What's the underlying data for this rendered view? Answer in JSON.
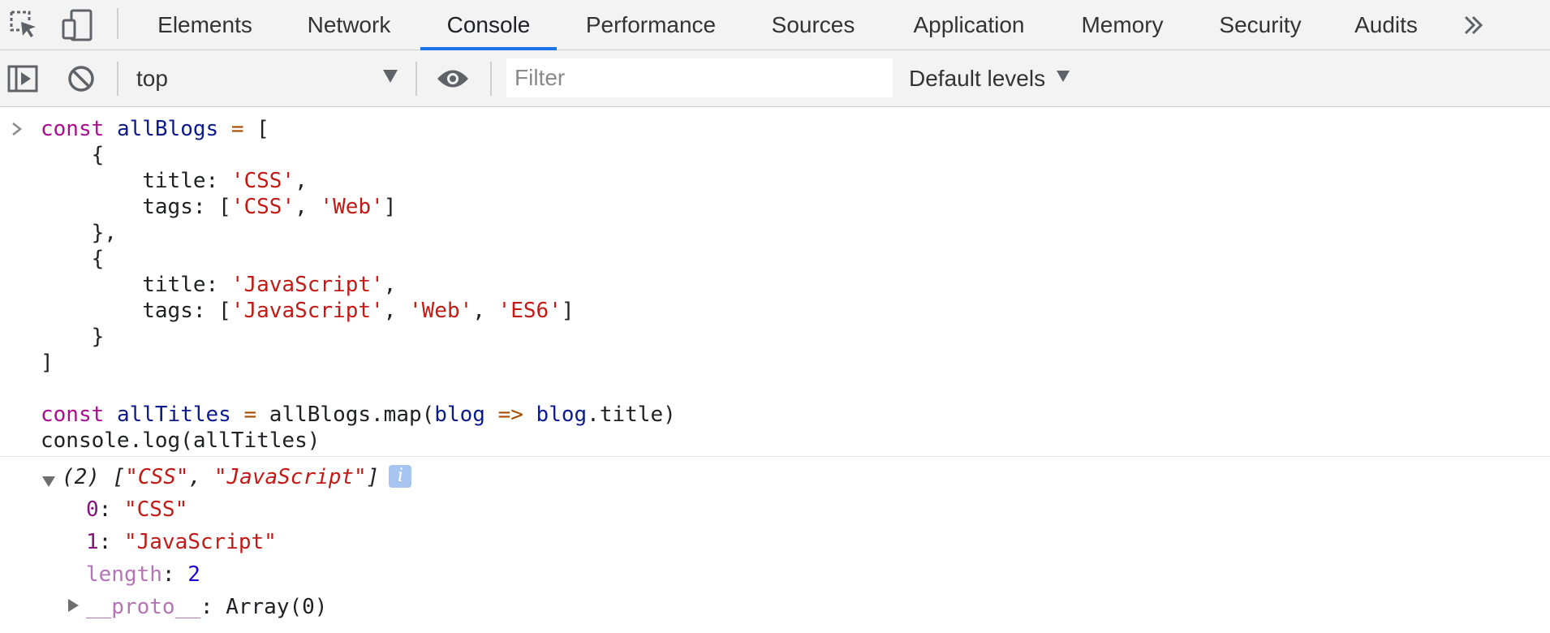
{
  "tabs": [
    {
      "label": "Elements",
      "active": false
    },
    {
      "label": "Network",
      "active": false
    },
    {
      "label": "Console",
      "active": true
    },
    {
      "label": "Performance",
      "active": false
    },
    {
      "label": "Sources",
      "active": false
    },
    {
      "label": "Application",
      "active": false
    },
    {
      "label": "Memory",
      "active": false
    },
    {
      "label": "Security",
      "active": false
    },
    {
      "label": "Audits",
      "active": false
    }
  ],
  "toolbar": {
    "context": "top",
    "filter_placeholder": "Filter",
    "levels": "Default levels"
  },
  "console_input": {
    "line1": {
      "kw": "const",
      "var": "allBlogs",
      "op": "=",
      "rest": "["
    },
    "obj1": {
      "title_key": "title:",
      "title_val": "'CSS'",
      "tags_key": "tags:",
      "tag1": "'CSS'",
      "tag2": "'Web'"
    },
    "obj2": {
      "title_key": "title:",
      "title_val": "'JavaScript'",
      "tags_key": "tags:",
      "tag1": "'JavaScript'",
      "tag2": "'Web'",
      "tag3": "'ES6'"
    },
    "line_map": {
      "kw": "const",
      "var": "allTitles",
      "op": "=",
      "call": "allBlogs.map(",
      "param": "blog",
      "arrow": "=>",
      "obj": "blog",
      "prop": ".title)"
    },
    "line_log": "console.log(allTitles)"
  },
  "console_output": {
    "summary_count": "(2)",
    "summary_item1": "\"CSS\"",
    "summary_item2": "\"JavaScript\"",
    "info": "i",
    "items": [
      {
        "key": "0",
        "value": "\"CSS\""
      },
      {
        "key": "1",
        "value": "\"JavaScript\""
      }
    ],
    "length_key": "length",
    "length_value": "2",
    "proto_key": "__proto__",
    "proto_value": "Array(0)"
  },
  "colors": {
    "accent": "#1a73e8",
    "keyword": "#aa0d91",
    "string": "#c41a16",
    "number": "#1c00cf"
  },
  "icons": {
    "inspect": "inspect-element-icon",
    "device": "device-toolbar-icon",
    "sidebar": "console-sidebar-icon",
    "clear": "clear-console-icon",
    "eye": "live-expression-icon",
    "overflow": "more-tabs-icon"
  }
}
